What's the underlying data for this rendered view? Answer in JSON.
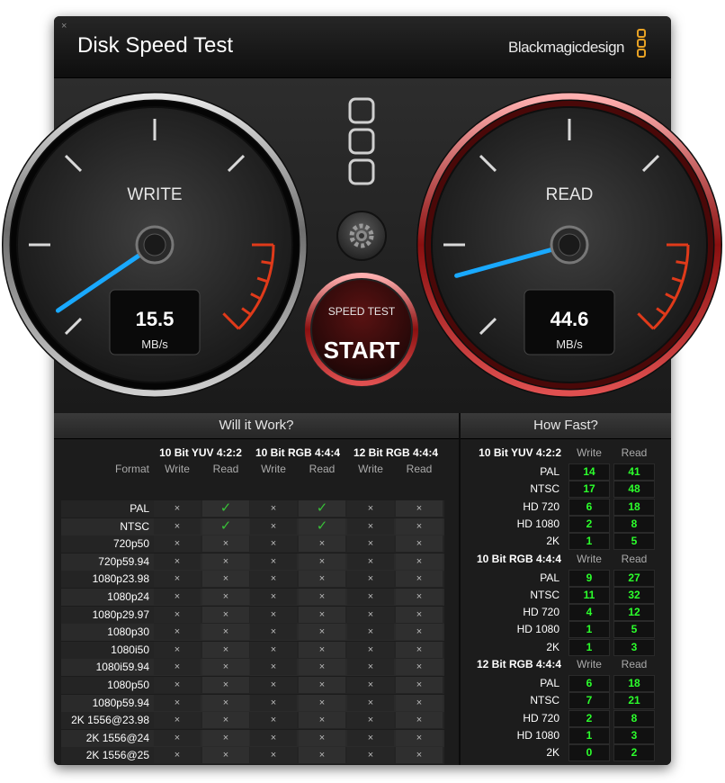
{
  "window": {
    "title": "Disk Speed Test",
    "brand": "Blackmagicdesign",
    "close_glyph": "×"
  },
  "gauges": {
    "write": {
      "label": "WRITE",
      "value": "15.5",
      "unit": "MB/s",
      "needle_fraction": 0.04
    },
    "read": {
      "label": "READ",
      "value": "44.6",
      "unit": "MB/s",
      "needle_fraction": 0.11
    }
  },
  "start_button": {
    "top_label": "SPEED TEST",
    "main_label": "START"
  },
  "icons": {
    "settings": "gear-icon",
    "logo": "blackmagic-logo-icon"
  },
  "colors": {
    "write_needle": "#19a9ff",
    "read_ring": "#b51a1a",
    "ok": "#38c038",
    "fast_value": "#2cff2c",
    "brand_accent": "#e8a224"
  },
  "will_it_work": {
    "title": "Will it Work?",
    "format_label": "Format",
    "groups": [
      "10 Bit YUV 4:2:2",
      "10 Bit RGB 4:4:4",
      "12 Bit RGB 4:4:4"
    ],
    "sub_labels": [
      "Write",
      "Read"
    ],
    "rows": [
      {
        "name": "PAL",
        "cells": [
          "x",
          "ok",
          "x",
          "ok",
          "x",
          "x"
        ]
      },
      {
        "name": "NTSC",
        "cells": [
          "x",
          "ok",
          "x",
          "ok",
          "x",
          "x"
        ]
      },
      {
        "name": "720p50",
        "cells": [
          "x",
          "x",
          "x",
          "x",
          "x",
          "x"
        ]
      },
      {
        "name": "720p59.94",
        "cells": [
          "x",
          "x",
          "x",
          "x",
          "x",
          "x"
        ]
      },
      {
        "name": "1080p23.98",
        "cells": [
          "x",
          "x",
          "x",
          "x",
          "x",
          "x"
        ]
      },
      {
        "name": "1080p24",
        "cells": [
          "x",
          "x",
          "x",
          "x",
          "x",
          "x"
        ]
      },
      {
        "name": "1080p29.97",
        "cells": [
          "x",
          "x",
          "x",
          "x",
          "x",
          "x"
        ]
      },
      {
        "name": "1080p30",
        "cells": [
          "x",
          "x",
          "x",
          "x",
          "x",
          "x"
        ]
      },
      {
        "name": "1080i50",
        "cells": [
          "x",
          "x",
          "x",
          "x",
          "x",
          "x"
        ]
      },
      {
        "name": "1080i59.94",
        "cells": [
          "x",
          "x",
          "x",
          "x",
          "x",
          "x"
        ]
      },
      {
        "name": "1080p50",
        "cells": [
          "x",
          "x",
          "x",
          "x",
          "x",
          "x"
        ]
      },
      {
        "name": "1080p59.94",
        "cells": [
          "x",
          "x",
          "x",
          "x",
          "x",
          "x"
        ]
      },
      {
        "name": "2K 1556@23.98",
        "cells": [
          "x",
          "x",
          "x",
          "x",
          "x",
          "x"
        ]
      },
      {
        "name": "2K 1556@24",
        "cells": [
          "x",
          "x",
          "x",
          "x",
          "x",
          "x"
        ]
      },
      {
        "name": "2K 1556@25",
        "cells": [
          "x",
          "x",
          "x",
          "x",
          "x",
          "x"
        ]
      }
    ]
  },
  "how_fast": {
    "title": "How Fast?",
    "sub_labels": [
      "Write",
      "Read"
    ],
    "groups": [
      {
        "name": "10 Bit YUV 4:2:2",
        "rows": [
          {
            "name": "PAL",
            "write": "14",
            "read": "41"
          },
          {
            "name": "NTSC",
            "write": "17",
            "read": "48"
          },
          {
            "name": "HD 720",
            "write": "6",
            "read": "18"
          },
          {
            "name": "HD 1080",
            "write": "2",
            "read": "8"
          },
          {
            "name": "2K",
            "write": "1",
            "read": "5"
          }
        ]
      },
      {
        "name": "10 Bit RGB 4:4:4",
        "rows": [
          {
            "name": "PAL",
            "write": "9",
            "read": "27"
          },
          {
            "name": "NTSC",
            "write": "11",
            "read": "32"
          },
          {
            "name": "HD 720",
            "write": "4",
            "read": "12"
          },
          {
            "name": "HD 1080",
            "write": "1",
            "read": "5"
          },
          {
            "name": "2K",
            "write": "1",
            "read": "3"
          }
        ]
      },
      {
        "name": "12 Bit RGB 4:4:4",
        "rows": [
          {
            "name": "PAL",
            "write": "6",
            "read": "18"
          },
          {
            "name": "NTSC",
            "write": "7",
            "read": "21"
          },
          {
            "name": "HD 720",
            "write": "2",
            "read": "8"
          },
          {
            "name": "HD 1080",
            "write": "1",
            "read": "3"
          },
          {
            "name": "2K",
            "write": "0",
            "read": "2"
          }
        ]
      }
    ]
  }
}
